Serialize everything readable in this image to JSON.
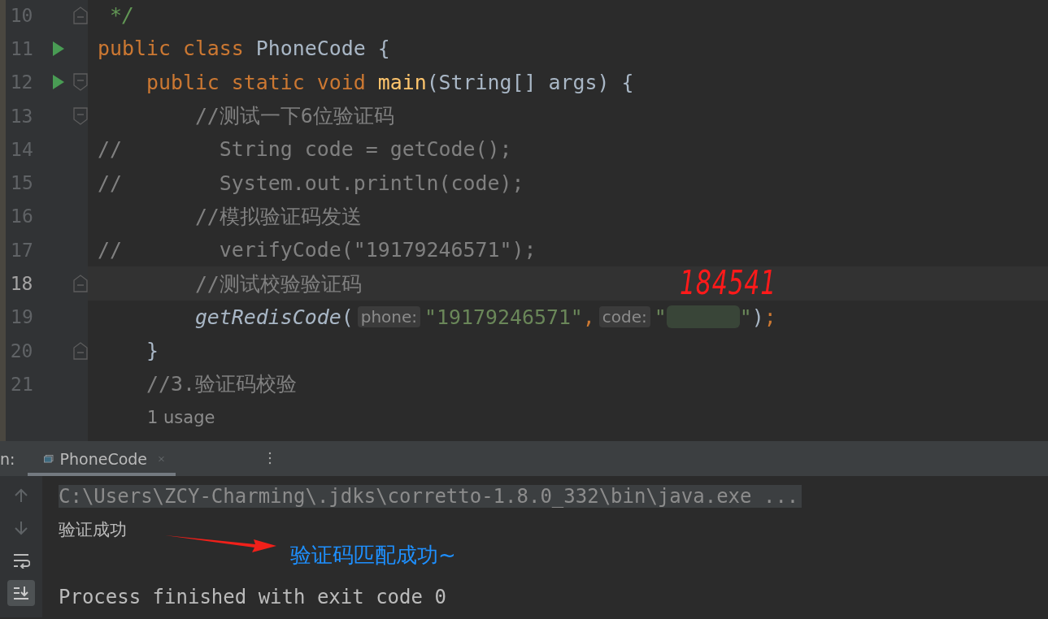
{
  "editor": {
    "lines": [
      {
        "number": "10",
        "run": false,
        "fold_start": false,
        "fold_end": true,
        "current": false,
        "tokens": [
          {
            "kind": "doc",
            "text": " */"
          }
        ]
      },
      {
        "number": "11",
        "run": true,
        "fold_start": false,
        "fold_end": false,
        "current": false,
        "tokens": [
          {
            "kind": "keyword",
            "text": "public class "
          },
          {
            "kind": "plain",
            "text": "PhoneCode {"
          }
        ]
      },
      {
        "number": "12",
        "run": true,
        "fold_start": true,
        "fold_end": false,
        "current": false,
        "tokens": [
          {
            "kind": "keyword",
            "text": "    public static void "
          },
          {
            "kind": "method",
            "text": "main"
          },
          {
            "kind": "plain",
            "text": "(String[] args) {"
          }
        ]
      },
      {
        "number": "13",
        "run": false,
        "fold_start": true,
        "fold_end": false,
        "current": false,
        "tokens": [
          {
            "kind": "comment",
            "text": "        //测试一下6位验证码"
          }
        ]
      },
      {
        "number": "14",
        "run": false,
        "fold_start": false,
        "fold_end": false,
        "current": false,
        "tokens": [
          {
            "kind": "comment",
            "text": "//        String code = getCode();"
          }
        ]
      },
      {
        "number": "15",
        "run": false,
        "fold_start": false,
        "fold_end": false,
        "current": false,
        "tokens": [
          {
            "kind": "comment",
            "text": "//        System.out.println(code);"
          }
        ]
      },
      {
        "number": "16",
        "run": false,
        "fold_start": false,
        "fold_end": false,
        "current": false,
        "tokens": [
          {
            "kind": "comment",
            "text": "        //模拟验证码发送"
          }
        ]
      },
      {
        "number": "17",
        "run": false,
        "fold_start": false,
        "fold_end": false,
        "current": false,
        "tokens": [
          {
            "kind": "comment",
            "text": "//        verifyCode(\"19179246571\");"
          }
        ]
      },
      {
        "number": "18",
        "run": false,
        "fold_start": false,
        "fold_end": true,
        "current": true,
        "tokens": [
          {
            "kind": "comment",
            "text": "        //测试校验验证码"
          }
        ]
      },
      {
        "number": "19",
        "run": false,
        "fold_start": false,
        "fold_end": false,
        "current": false,
        "tokens": [
          {
            "kind": "call",
            "text": "        getRedisCode"
          },
          {
            "kind": "plain",
            "text": "("
          },
          {
            "kind": "hint",
            "text": "phone:"
          },
          {
            "kind": "string",
            "text": "\"19179246571\""
          },
          {
            "kind": "keyword",
            "text": ","
          },
          {
            "kind": "hint",
            "text": "code:"
          },
          {
            "kind": "string",
            "text": "\""
          },
          {
            "kind": "redaction"
          },
          {
            "kind": "string",
            "text": "\""
          },
          {
            "kind": "plain",
            "text": ")"
          },
          {
            "kind": "keyword",
            "text": ";"
          }
        ]
      },
      {
        "number": "20",
        "run": false,
        "fold_start": false,
        "fold_end": true,
        "current": false,
        "tokens": [
          {
            "kind": "plain",
            "text": "    }"
          }
        ]
      },
      {
        "number": "21",
        "run": false,
        "fold_start": false,
        "fold_end": false,
        "current": false,
        "tokens": [
          {
            "kind": "comment",
            "text": "    //3.验证码校验"
          }
        ]
      }
    ],
    "usage_hint": "1 usage"
  },
  "run_panel": {
    "label": "n:",
    "tab": {
      "title": "PhoneCode",
      "selected": true
    },
    "output": [
      {
        "kind": "command",
        "text": "C:\\Users\\ZCY-Charming\\.jdks\\corretto-1.8.0_332\\bin\\java.exe ..."
      },
      {
        "kind": "stdout",
        "text": "验证成功"
      },
      {
        "kind": "blank"
      },
      {
        "kind": "system",
        "text": "Process finished with exit code 0"
      }
    ]
  },
  "annotations": {
    "handwritten_code": "184541",
    "note": "验证码匹配成功~"
  }
}
